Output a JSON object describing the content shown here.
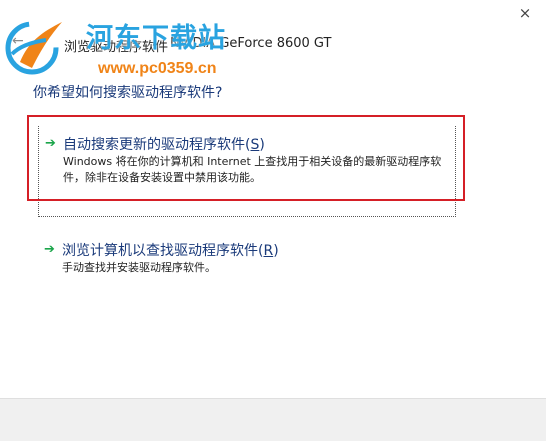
{
  "window": {
    "close_glyph": "×",
    "back_glyph": "←",
    "header_text_left": "浏览驱动程序软件",
    "header_device": "NVIDIA GeForce 8600 GT"
  },
  "watermark": {
    "title": "河东下载站",
    "url": "www.pc0359.cn"
  },
  "question": "你希望如何搜索驱动程序软件?",
  "options": [
    {
      "title": "自动搜索更新的驱动程序软件",
      "access_key": "S",
      "description": "Windows 将在你的计算机和 Internet 上查找用于相关设备的最新驱动程序软件，除非在设备安装设置中禁用该功能。",
      "icon": "green-arrow-icon"
    },
    {
      "title": "浏览计算机以查找驱动程序软件",
      "access_key": "R",
      "description": "手动查找并安装驱动程序软件。",
      "icon": "green-arrow-icon"
    }
  ],
  "colors": {
    "link_blue": "#1a3a7a",
    "arrow_green": "#1aa54a",
    "highlight_red": "#d51f26",
    "watermark_blue": "#29a3e0",
    "watermark_orange": "#f08418"
  }
}
